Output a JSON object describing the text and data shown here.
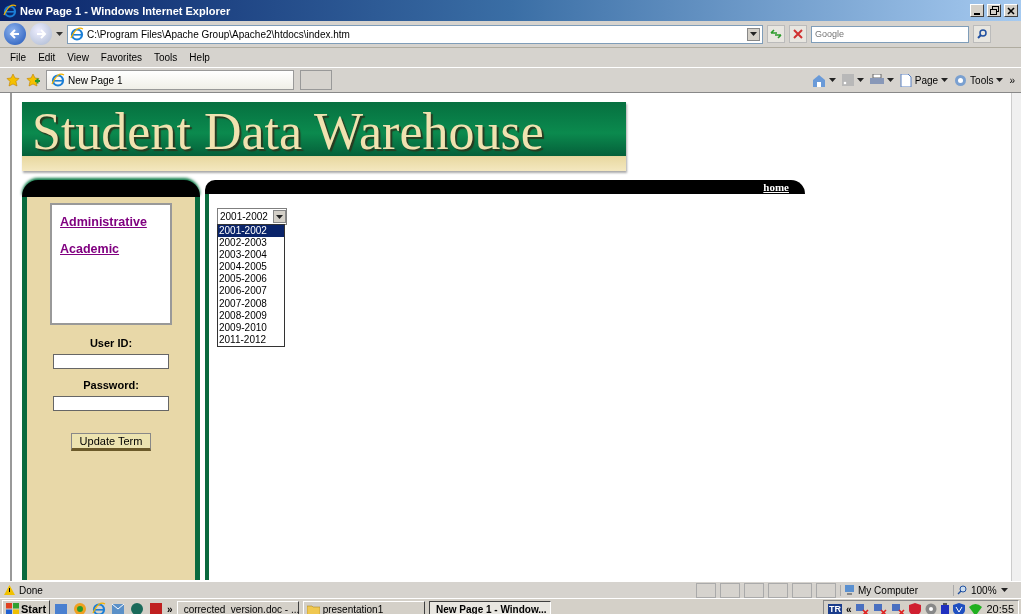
{
  "window": {
    "title": "New Page 1 - Windows Internet Explorer"
  },
  "address_bar": {
    "url": "C:\\Program Files\\Apache Group\\Apache2\\htdocs\\index.htm"
  },
  "search": {
    "placeholder": "Google"
  },
  "menu": [
    "File",
    "Edit",
    "View",
    "Favorites",
    "Tools",
    "Help"
  ],
  "tabs": [
    {
      "label": "New Page 1",
      "selected": true
    }
  ],
  "command_bar": {
    "items": [
      {
        "kind": "home"
      },
      {
        "kind": "feeds"
      },
      {
        "kind": "print"
      },
      {
        "kind": "page",
        "label": "Page"
      },
      {
        "kind": "tools",
        "label": "Tools"
      }
    ],
    "overflow": "»"
  },
  "page": {
    "banner": "Student Data Warehouse",
    "nav": [
      "Administrative",
      "Academic"
    ],
    "home_link": "home",
    "user_id_label": "User ID:",
    "password_label": "Password:",
    "button": "Update Term",
    "term_select": {
      "value": "2001-2002",
      "expanded": true,
      "options": [
        {
          "label": "2001-2002",
          "selected": true
        },
        {
          "label": "2002-2003",
          "selected": false
        },
        {
          "label": "2003-2004",
          "selected": false
        },
        {
          "label": "2004-2005",
          "selected": false
        },
        {
          "label": "2005-2006",
          "selected": false
        },
        {
          "label": "2006-2007",
          "selected": false
        },
        {
          "label": "2007-2008",
          "selected": false
        },
        {
          "label": "2008-2009",
          "selected": false
        },
        {
          "label": "2009-2010",
          "selected": false
        },
        {
          "label": "2011-2012",
          "selected": false
        }
      ]
    }
  },
  "status_bar": {
    "text": "Done",
    "zone": "My Computer",
    "zoom": "100%"
  },
  "taskbar": {
    "start": "Start",
    "overflow": "»",
    "tasks": [
      {
        "label": "corrected_version.doc - ...",
        "kind": "doc",
        "selected": false
      },
      {
        "label": "presentation1",
        "kind": "folder",
        "selected": false
      },
      {
        "label": "New Page 1 - Window...",
        "kind": "ie",
        "selected": true
      }
    ],
    "tray_expand": "«",
    "tray_text": "TR",
    "clock": "20:55"
  }
}
